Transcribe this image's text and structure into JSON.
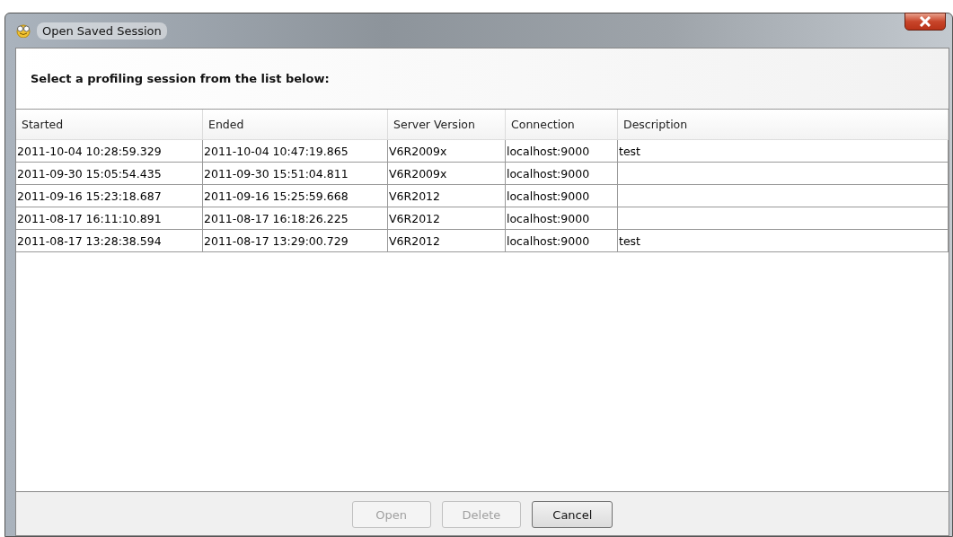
{
  "window": {
    "title": "Open Saved Session"
  },
  "instruction": "Select a profiling session from the list below:",
  "table": {
    "columns": [
      "Started",
      "Ended",
      "Server Version",
      "Connection",
      "Description"
    ],
    "rows": [
      {
        "cells": [
          "2011-10-04 10:28:59.329",
          "2011-10-04 10:47:19.865",
          "V6R2009x",
          "localhost:9000",
          "test"
        ],
        "selected": false
      },
      {
        "cells": [
          "2011-09-30 15:05:54.435",
          "2011-09-30 15:51:04.811",
          "V6R2009x",
          "localhost:9000",
          ""
        ],
        "selected": false
      },
      {
        "cells": [
          "2011-09-16 15:23:18.687",
          "2011-09-16 15:25:59.668",
          "V6R2012",
          "localhost:9000",
          ""
        ],
        "selected": false
      },
      {
        "cells": [
          "2011-08-17 16:11:10.891",
          "2011-08-17 16:18:26.225",
          "V6R2012",
          "localhost:9000",
          ""
        ],
        "selected": false
      },
      {
        "cells": [
          "2011-08-17 13:28:38.594",
          "2011-08-17 13:29:00.729",
          "V6R2012",
          "localhost:9000",
          "test"
        ],
        "selected": false
      }
    ]
  },
  "buttons": [
    {
      "label": "Open",
      "disabled": true
    },
    {
      "label": "Delete",
      "disabled": true
    },
    {
      "label": "Cancel",
      "disabled": false
    }
  ]
}
